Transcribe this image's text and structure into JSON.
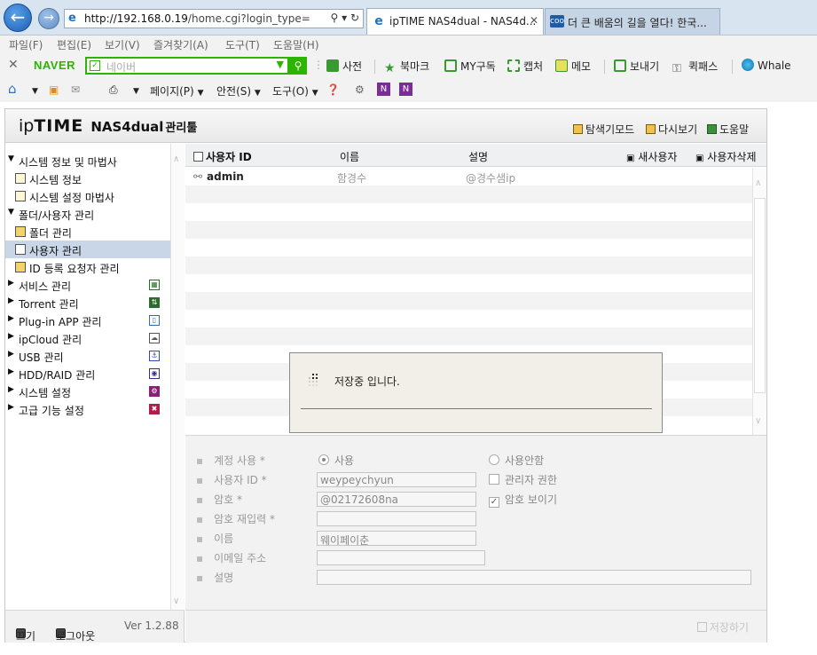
{
  "browser": {
    "url_host": "http://192.168.0.19",
    "url_path": "/home.cgi?login_type=",
    "tabs": [
      {
        "title": "ipTIME NAS4dual - NAS4d...",
        "active": true
      },
      {
        "title": "더 큰 배움의 길을 열다! 한국...",
        "active": false
      }
    ],
    "menu": [
      "파일(F)",
      "편집(E)",
      "보기(V)",
      "즐겨찾기(A)",
      "도구(T)",
      "도움말(H)"
    ],
    "naver": {
      "logo": "NAVER",
      "placeholder": "네이버",
      "items": [
        "사전",
        "북마크",
        "MY구독",
        "캡처",
        "메모",
        "보내기",
        "퀵패스",
        "Whale"
      ]
    },
    "command": {
      "page": "페이지(P)",
      "safety": "안전(S)",
      "tools": "도구(O)"
    }
  },
  "app": {
    "brand_ip": "ip",
    "brand_time": "TIME",
    "brand_model": "NAS4dual",
    "brand_tool": "관리툴",
    "header_links": [
      "탐색기모드",
      "다시보기",
      "도움말"
    ],
    "sidebar": {
      "items": [
        {
          "label": "시스템 정보 및 마법사",
          "type": "group",
          "open": true
        },
        {
          "label": "시스템 정보",
          "type": "child"
        },
        {
          "label": "시스템 설정 마법사",
          "type": "child"
        },
        {
          "label": "폴더/사용자 관리",
          "type": "group",
          "open": true
        },
        {
          "label": "폴더 관리",
          "type": "child"
        },
        {
          "label": "사용자 관리",
          "type": "child",
          "selected": true
        },
        {
          "label": "ID 등록 요청자 관리",
          "type": "child"
        },
        {
          "label": "서비스 관리",
          "type": "group",
          "open": false
        },
        {
          "label": "Torrent 관리",
          "type": "group",
          "open": false
        },
        {
          "label": "Plug-in APP 관리",
          "type": "group",
          "open": false
        },
        {
          "label": "ipCloud 관리",
          "type": "group",
          "open": false
        },
        {
          "label": "USB 관리",
          "type": "group",
          "open": false
        },
        {
          "label": "HDD/RAID 관리",
          "type": "group",
          "open": false
        },
        {
          "label": "시스템 설정",
          "type": "group",
          "open": false
        },
        {
          "label": "고급 기능 설정",
          "type": "group",
          "open": false
        }
      ],
      "footer": {
        "power": "끄기",
        "logout": "로그아웃",
        "version": "Ver 1.2.88"
      }
    },
    "table": {
      "headers": [
        "사용자 ID",
        "이름",
        "설명"
      ],
      "add_user": "새사용자",
      "delete_user": "사용자삭제",
      "rows": [
        {
          "id": "admin",
          "name": "함경수",
          "desc": "@경수샘ip"
        }
      ]
    },
    "form": {
      "account_use_label": "계정 사용 *",
      "use_opt": "사용",
      "nouse_opt": "사용안함",
      "user_id_label": "사용자 ID *",
      "user_id_value": "weypeychyun",
      "admin_opt": "관리자 권한",
      "password_label": "암호 *",
      "password_value": "@02172608na",
      "show_password_opt": "암호 보이기",
      "password_confirm_label": "암호 재입력 *",
      "name_label": "이름",
      "name_value": "웨이페이춘",
      "email_label": "이메일 주소",
      "desc_label": "설명",
      "save_label": "저장하기"
    },
    "dialog": {
      "message": "저장중 입니다."
    }
  }
}
